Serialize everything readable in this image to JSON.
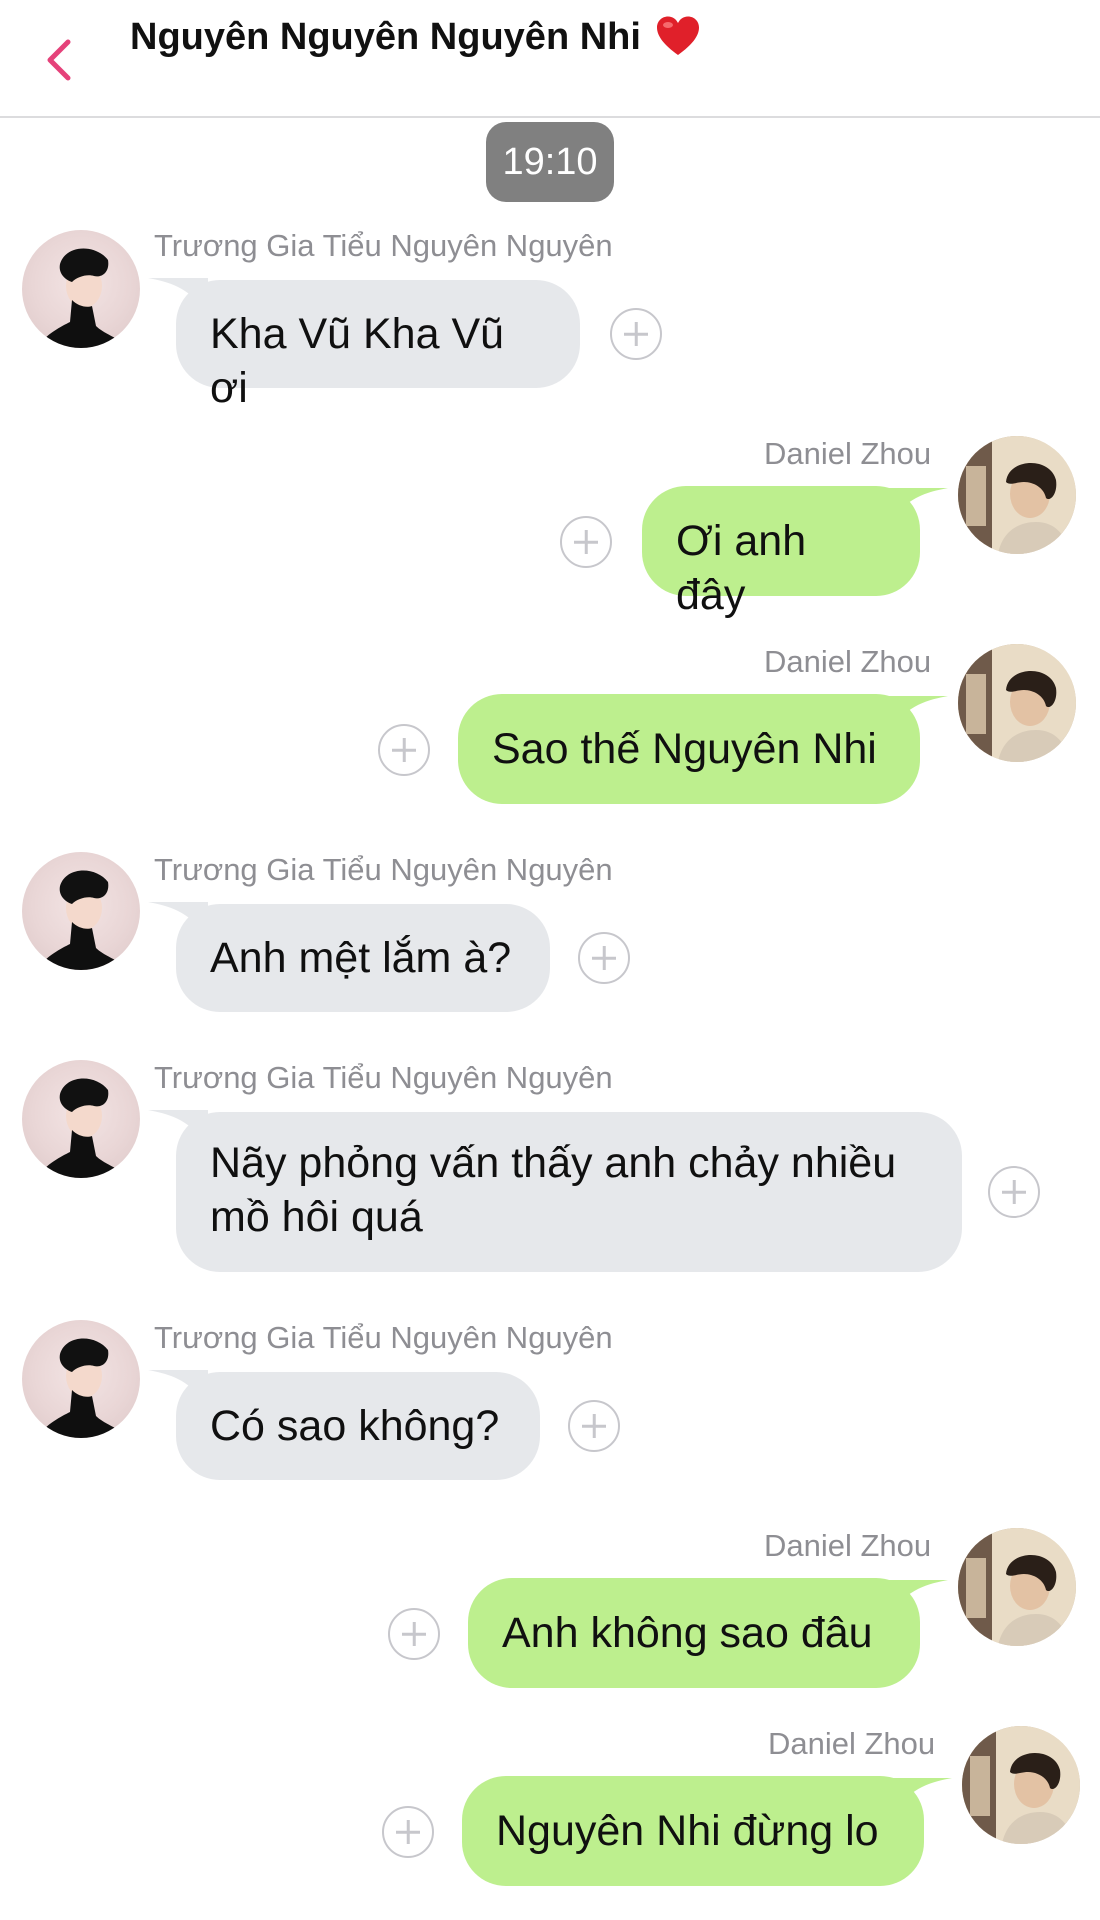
{
  "header": {
    "title": "Nguyên Nguyên Nguyên Nhi",
    "title_icon": "heart-icon",
    "accent_color": "#e5427a"
  },
  "timestamp": "19:10",
  "messages": [
    {
      "sender": "Trương Gia Tiểu Nguyên Nguyên",
      "side": "left",
      "text": "Kha Vũ Kha Vũ ơi"
    },
    {
      "sender": "Daniel Zhou",
      "side": "right",
      "text": "Ơi anh đây"
    },
    {
      "sender": "Daniel Zhou",
      "side": "right",
      "text": "Sao thế Nguyên Nhi"
    },
    {
      "sender": "Trương Gia Tiểu Nguyên Nguyên",
      "side": "left",
      "text": "Anh mệt lắm à?"
    },
    {
      "sender": "Trương Gia Tiểu Nguyên Nguyên",
      "side": "left",
      "text": "Nãy phỏng vấn thấy anh chảy nhiều mồ hôi quá"
    },
    {
      "sender": "Trương Gia Tiểu Nguyên Nguyên",
      "side": "left",
      "text": "Có sao không?"
    },
    {
      "sender": "Daniel Zhou",
      "side": "right",
      "text": "Anh không sao đâu"
    },
    {
      "sender": "Daniel Zhou",
      "side": "right",
      "text": "Nguyên Nhi đừng lo"
    }
  ],
  "colors": {
    "left_bubble": "#e6e8eb",
    "right_bubble": "#bdef8e",
    "sender_name": "#8e8e93",
    "timestamp_bg": "#808080"
  }
}
